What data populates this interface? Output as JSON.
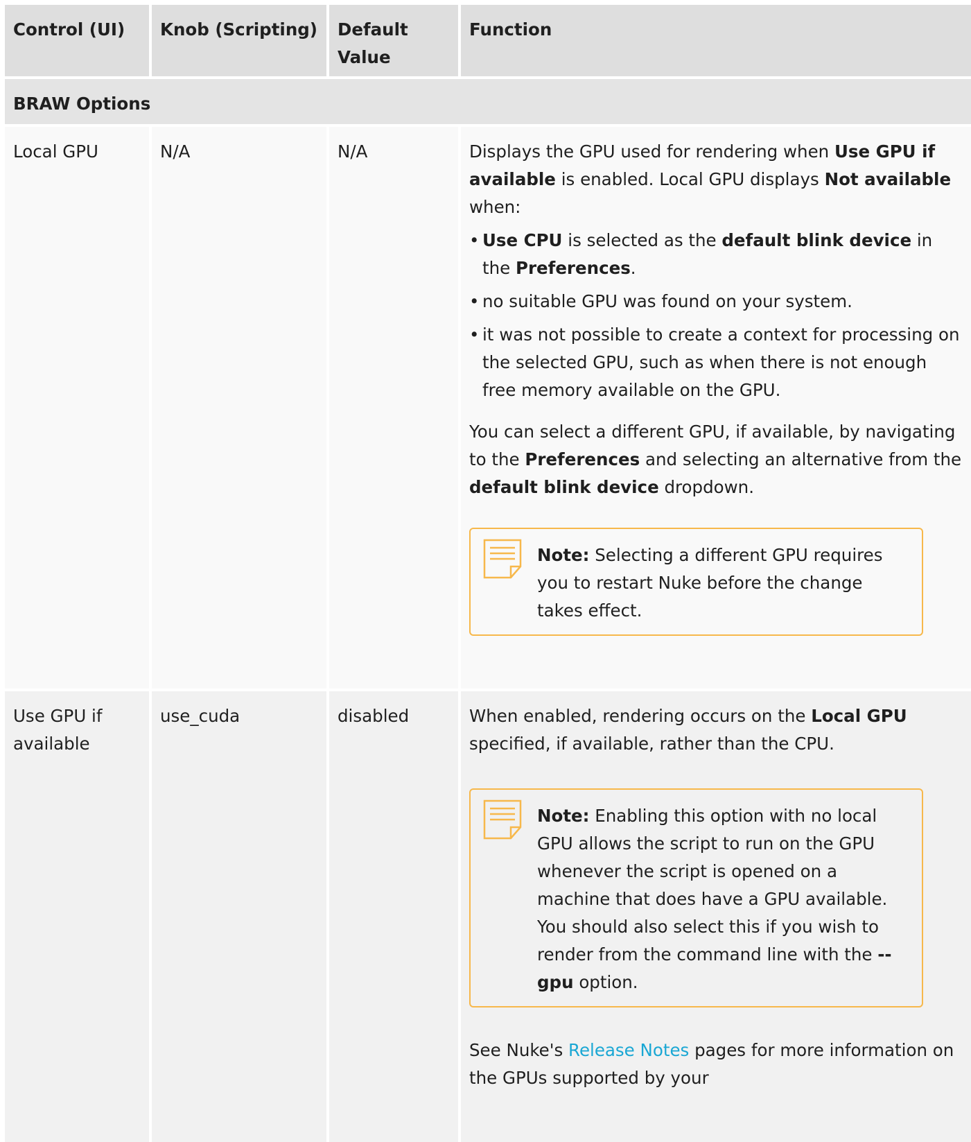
{
  "table": {
    "headers": [
      "Control (UI)",
      "Knob (Scripting)",
      "Default Value",
      "Function"
    ],
    "section": "BRAW Options",
    "rows": [
      {
        "control": "Local GPU",
        "knob": "N/A",
        "default": "N/A",
        "function": {
          "intro_1": "Displays the GPU used for rendering when ",
          "intro_b1": "Use GPU if available",
          "intro_2": " is enabled. Local GPU displays ",
          "intro_b2": "Not available",
          "intro_3": " when:",
          "bullets": [
            {
              "dot": "•",
              "b1": "Use CPU",
              "t1": " is selected as the ",
              "b2": "default blink device",
              "t2": " in the ",
              "b3": "Preferences",
              "t3": "."
            },
            {
              "dot": "•",
              "text": "no suitable GPU was found on your system."
            },
            {
              "dot": "•",
              "text": "it was not possible to create a context for processing on the selected GPU, such as when there is not enough free memory available on the GPU."
            }
          ],
          "para_1": "You can select a different GPU, if available, by navigating to the ",
          "para_b1": "Preferences",
          "para_2": " and selecting an alternative from the ",
          "para_b2": "default blink device",
          "para_3": " dropdown.",
          "note_label": "Note:",
          "note_text": " Selecting a different GPU requires you to restart Nuke before the change takes effect."
        }
      },
      {
        "control": "Use GPU if available",
        "knob": "use_cuda",
        "default": "disabled",
        "function": {
          "intro_1": "When enabled, rendering occurs on the ",
          "intro_b1": "Local GPU",
          "intro_2": " specified, if available, rather than the CPU.",
          "note_label": "Note:",
          "note_text": " Enabling this option with no local GPU allows the script to run on the GPU whenever the script is opened on a machine that does have a GPU available. You should also select this if you wish to render from the command line with the ",
          "note_b": "--gpu",
          "note_end": " option.",
          "see_1": "See Nuke's ",
          "see_link": "Release Notes",
          "see_2": " pages for more information on the GPUs supported by your"
        }
      }
    ]
  },
  "icons": {
    "note_icon": "note-document-icon",
    "note_icon_color": "#f7b84b"
  },
  "colors": {
    "header_bg": "#dedede",
    "note_border": "#f7b84b",
    "link": "#1aa7d4"
  }
}
